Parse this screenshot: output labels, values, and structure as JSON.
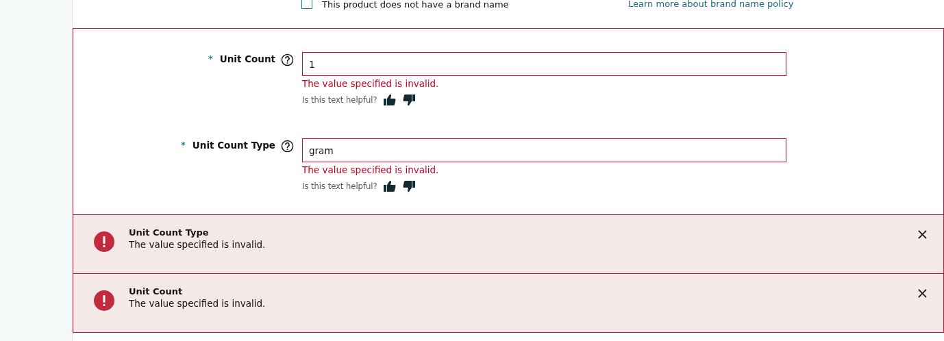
{
  "brand_row": {
    "checkbox": {
      "label": "This product does not have a brand name",
      "checked": false
    },
    "link": "Learn more about brand name policy"
  },
  "fields": [
    {
      "label": "Unit Count",
      "required_mark": "*",
      "value": "1",
      "error": "The value specified is invalid.",
      "feedback_prompt": "Is this text helpful?"
    },
    {
      "label": "Unit Count Type",
      "required_mark": "*",
      "value": "gram",
      "error": "The value specified is invalid.",
      "feedback_prompt": "Is this text helpful?"
    }
  ],
  "alerts": [
    {
      "title": "Unit Count Type",
      "message": "The value specified is invalid."
    },
    {
      "title": "Unit Count",
      "message": "The value specified is invalid."
    }
  ]
}
